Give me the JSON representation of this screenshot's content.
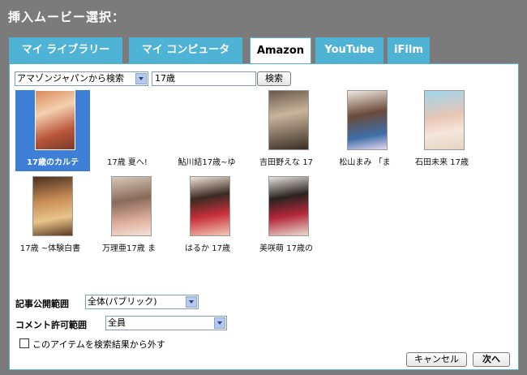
{
  "header": {
    "title": "挿入ムービー選択："
  },
  "tabs": [
    {
      "label": "マイ ライブラリー"
    },
    {
      "label": "マイ コンピュータ"
    },
    {
      "label": "Amazon"
    },
    {
      "label": "YouTube"
    },
    {
      "label": "iFilm"
    }
  ],
  "active_tab": "Amazon",
  "search": {
    "source_select": "アマゾンジャパンから検索",
    "query": "17歳",
    "button_label": "検索"
  },
  "results": [
    {
      "label": "17歳のカルテ",
      "selected": true
    },
    {
      "label": "17歳 夏へ!",
      "selected": false
    },
    {
      "label": "鮎川結17歳~ゆ",
      "selected": false
    },
    {
      "label": "吉田野えな 17",
      "selected": false
    },
    {
      "label": "松山まみ 「ま",
      "selected": false
    },
    {
      "label": "石田未来 17歳",
      "selected": false
    },
    {
      "label": "17歳 ~体験白書",
      "selected": false
    },
    {
      "label": "万理亜17歳 ま",
      "selected": false
    },
    {
      "label": "はるか 17歳",
      "selected": false
    },
    {
      "label": "美咲萌 17歳の",
      "selected": false
    }
  ],
  "form": {
    "visibility_label": "記事公開範囲",
    "visibility_value": "全体(パブリック)",
    "comment_label": "コメント許可範囲",
    "comment_value": "全員",
    "exclude_label": "このアイテムを検索結果から外す",
    "exclude_checked": false
  },
  "footer": {
    "cancel_label": "キャンセル",
    "next_label": "次へ"
  },
  "colors": {
    "background": "#7b7b7b",
    "tab": "#4fb3d6",
    "selected": "#3d7fd6"
  }
}
